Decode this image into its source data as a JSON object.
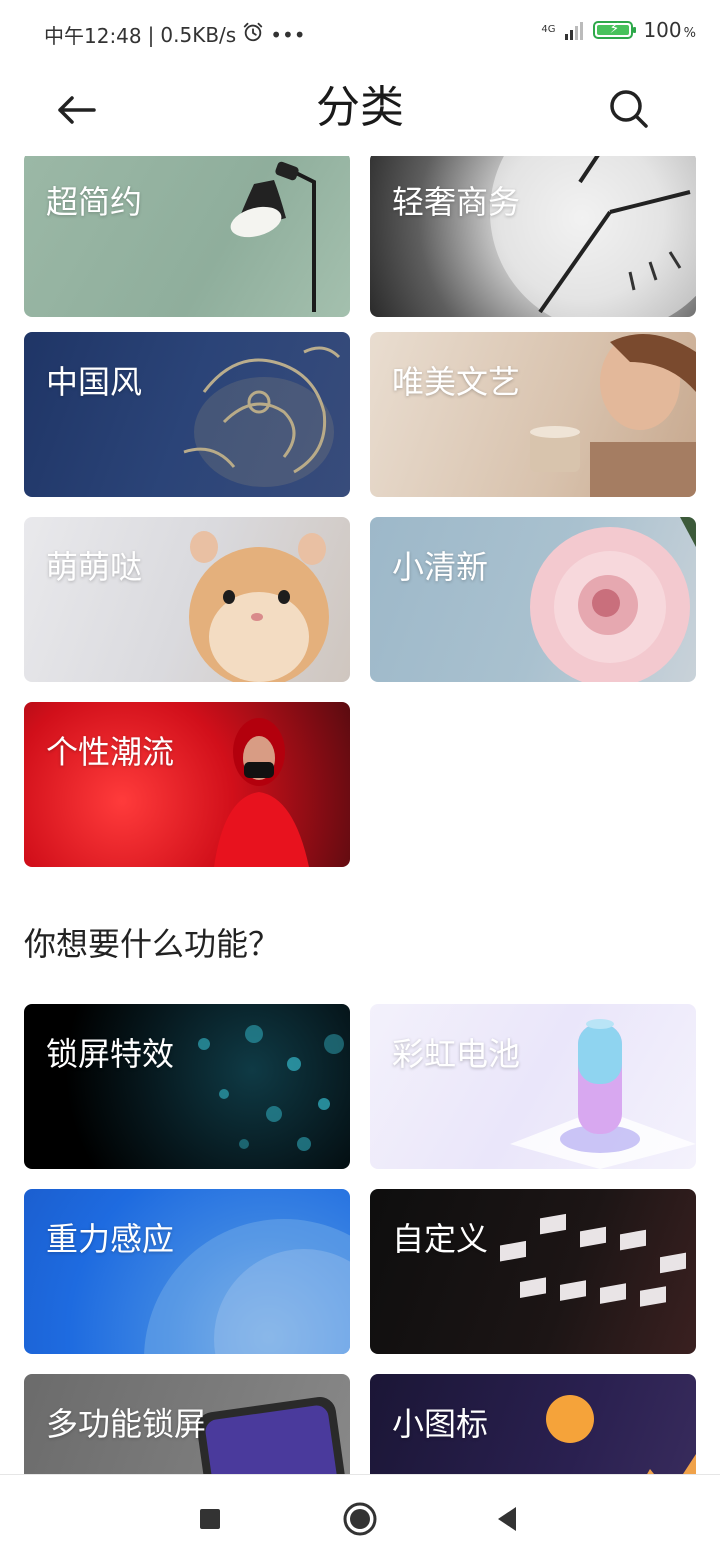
{
  "status_bar": {
    "time": "中午12:48",
    "separator": "|",
    "speed": "0.5KB/s",
    "dots": "•••",
    "network": "4G",
    "battery": "100",
    "battery_unit": "%"
  },
  "header": {
    "title": "分类"
  },
  "styles": [
    {
      "label": "超简约"
    },
    {
      "label": "轻奢商务"
    },
    {
      "label": "中国风"
    },
    {
      "label": "唯美文艺"
    },
    {
      "label": "萌萌哒"
    },
    {
      "label": "小清新"
    },
    {
      "label": "个性潮流"
    }
  ],
  "features_title": "你想要什么功能？",
  "features": [
    {
      "label": "锁屏特效"
    },
    {
      "label": "彩虹电池"
    },
    {
      "label": "重力感应"
    },
    {
      "label": "自定义"
    },
    {
      "label": "多功能锁屏"
    },
    {
      "label": "小图标"
    }
  ],
  "accent_colors": {
    "battery_green": "#47c25b"
  }
}
